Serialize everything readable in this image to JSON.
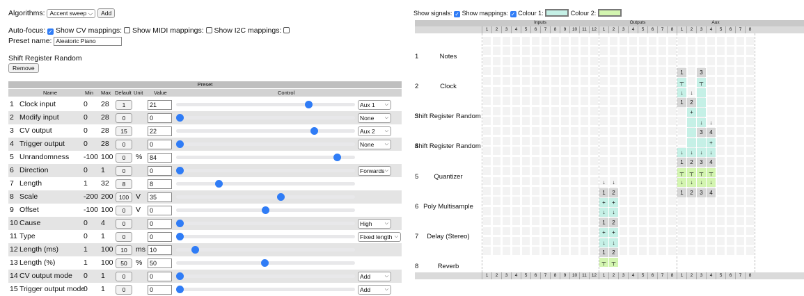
{
  "left_panel": {
    "algorithms_label": "Algorithms:",
    "algorithm_selected": "Accent sweep",
    "add_button": "Add",
    "auto_focus_label": "Auto-focus:",
    "show_cv_label": "Show CV mappings:",
    "show_midi_label": "Show MIDI mappings:",
    "show_i2c_label": "Show I2C mappings:",
    "preset_name_label": "Preset name:",
    "preset_name_value": "Aleatoric Piano",
    "algorithm_title": "Shift Register Random",
    "remove_button": "Remove",
    "table_title": "Preset",
    "headers": {
      "name": "Name",
      "min": "Min",
      "max": "Max",
      "default": "Default",
      "unit": "Unit",
      "value": "Value",
      "control": "Control"
    },
    "rows": [
      {
        "num": "1",
        "name": "Clock input",
        "min": "0",
        "max": "28",
        "default": "1",
        "unit": "",
        "value": "21",
        "slider": 0.75,
        "select": "Aux 1"
      },
      {
        "num": "2",
        "name": "Modify input",
        "min": "0",
        "max": "28",
        "default": "0",
        "unit": "",
        "value": "0",
        "slider": 0.0,
        "select": "None"
      },
      {
        "num": "3",
        "name": "CV output",
        "min": "0",
        "max": "28",
        "default": "15",
        "unit": "",
        "value": "22",
        "slider": 0.786,
        "select": "Aux 2"
      },
      {
        "num": "4",
        "name": "Trigger output",
        "min": "0",
        "max": "28",
        "default": "0",
        "unit": "",
        "value": "0",
        "slider": 0.0,
        "select": "None"
      },
      {
        "num": "5",
        "name": "Unrandomness",
        "min": "-100",
        "max": "100",
        "default": "0",
        "unit": "%",
        "value": "84",
        "slider": 0.92,
        "select": ""
      },
      {
        "num": "6",
        "name": "Direction",
        "min": "0",
        "max": "1",
        "default": "0",
        "unit": "",
        "value": "0",
        "slider": 0.0,
        "select": "Forwards"
      },
      {
        "num": "7",
        "name": "Length",
        "min": "1",
        "max": "32",
        "default": "8",
        "unit": "",
        "value": "8",
        "slider": 0.226,
        "select": ""
      },
      {
        "num": "8",
        "name": "Scale",
        "min": "-200",
        "max": "200",
        "default": "100",
        "unit": "V",
        "value": "35",
        "slider": 0.588,
        "select": ""
      },
      {
        "num": "9",
        "name": "Offset",
        "min": "-100",
        "max": "100",
        "default": "0",
        "unit": "V",
        "value": "0",
        "slider": 0.5,
        "select": ""
      },
      {
        "num": "10",
        "name": "Cause",
        "min": "0",
        "max": "4",
        "default": "0",
        "unit": "",
        "value": "0",
        "slider": 0.0,
        "select": "High"
      },
      {
        "num": "11",
        "name": "Type",
        "min": "0",
        "max": "1",
        "default": "0",
        "unit": "",
        "value": "0",
        "slider": 0.0,
        "select": "Fixed length"
      },
      {
        "num": "12",
        "name": "Length (ms)",
        "min": "1",
        "max": "100",
        "default": "10",
        "unit": "ms",
        "value": "10",
        "slider": 0.091,
        "select": ""
      },
      {
        "num": "13",
        "name": "Length (%)",
        "min": "1",
        "max": "100",
        "default": "50",
        "unit": "%",
        "value": "50",
        "slider": 0.495,
        "select": ""
      },
      {
        "num": "14",
        "name": "CV output mode",
        "min": "0",
        "max": "1",
        "default": "0",
        "unit": "",
        "value": "0",
        "slider": 0.0,
        "select": "Add"
      },
      {
        "num": "15",
        "name": "Trigger output mode",
        "min": "0",
        "max": "1",
        "default": "0",
        "unit": "",
        "value": "0",
        "slider": 0.0,
        "select": "Add"
      }
    ]
  },
  "right_panel": {
    "show_signals_label": "Show signals:",
    "show_mappings_label": "Show mappings:",
    "colour1_label": "Colour 1:",
    "colour2_label": "Colour 2:",
    "colour1": "#c5f0e6",
    "colour2": "#d3f5b0",
    "group_headers": {
      "inputs": "Inputs",
      "outputs": "Outputs",
      "aux": "Aux"
    },
    "input_numbers": [
      "1",
      "2",
      "3",
      "4",
      "5",
      "6",
      "7",
      "8",
      "9",
      "10",
      "11",
      "12"
    ],
    "output_numbers": [
      "1",
      "2",
      "3",
      "4",
      "5",
      "6",
      "7",
      "8"
    ],
    "aux_numbers": [
      "1",
      "2",
      "3",
      "4",
      "5",
      "6",
      "7",
      "8"
    ],
    "nodes": [
      {
        "num": "1",
        "name": "Notes"
      },
      {
        "num": "2",
        "name": "Clock"
      },
      {
        "num": "3",
        "name": "Shift Register Random"
      },
      {
        "num": "4",
        "name": "Shift Register Random"
      },
      {
        "num": "5",
        "name": "Quantizer"
      },
      {
        "num": "6",
        "name": "Poly Multisample"
      },
      {
        "num": "7",
        "name": "Delay (Stereo)"
      },
      {
        "num": "8",
        "name": "Reverb"
      }
    ],
    "signals": [
      {
        "row": 2,
        "col": 20,
        "text": "1",
        "c": "g"
      },
      {
        "row": 2,
        "col": 22,
        "text": "3",
        "c": "g"
      },
      {
        "row": 3,
        "col": 20,
        "text": "┬",
        "c": "c1"
      },
      {
        "row": 3,
        "col": 22,
        "text": "┬",
        "c": "c1"
      },
      {
        "row": 4,
        "col": 20,
        "text": "↓",
        "c": "c1"
      },
      {
        "row": 4,
        "col": 21,
        "text": "↓",
        "c": "n"
      },
      {
        "row": 4,
        "col": 22,
        "text": "",
        "c": "c1"
      },
      {
        "row": 5,
        "col": 20,
        "text": "1",
        "c": "g"
      },
      {
        "row": 5,
        "col": 21,
        "text": "2",
        "c": "g"
      },
      {
        "row": 5,
        "col": 22,
        "text": "",
        "c": "c1"
      },
      {
        "row": 6,
        "col": 21,
        "text": "+",
        "c": "c1"
      },
      {
        "row": 6,
        "col": 22,
        "text": "",
        "c": "c1"
      },
      {
        "row": 7,
        "col": 21,
        "text": "",
        "c": "c1"
      },
      {
        "row": 7,
        "col": 22,
        "text": "↓",
        "c": "c1"
      },
      {
        "row": 7,
        "col": 23,
        "text": "↓",
        "c": "n"
      },
      {
        "row": 8,
        "col": 21,
        "text": "",
        "c": "c1"
      },
      {
        "row": 8,
        "col": 22,
        "text": "3",
        "c": "g"
      },
      {
        "row": 8,
        "col": 23,
        "text": "4",
        "c": "g"
      },
      {
        "row": 9,
        "col": 21,
        "text": "",
        "c": "c1"
      },
      {
        "row": 9,
        "col": 22,
        "text": "",
        "c": "c1"
      },
      {
        "row": 9,
        "col": 23,
        "text": "+",
        "c": "c1"
      },
      {
        "row": 10,
        "col": 20,
        "text": "↓",
        "c": "c1"
      },
      {
        "row": 10,
        "col": 21,
        "text": "↓",
        "c": "c1"
      },
      {
        "row": 10,
        "col": 22,
        "text": "↓",
        "c": "c1"
      },
      {
        "row": 10,
        "col": 23,
        "text": "↓",
        "c": "c1"
      },
      {
        "row": 11,
        "col": 20,
        "text": "1",
        "c": "g"
      },
      {
        "row": 11,
        "col": 21,
        "text": "2",
        "c": "g"
      },
      {
        "row": 11,
        "col": 22,
        "text": "3",
        "c": "g"
      },
      {
        "row": 11,
        "col": 23,
        "text": "4",
        "c": "g"
      },
      {
        "row": 12,
        "col": 20,
        "text": "┬",
        "c": "c2"
      },
      {
        "row": 12,
        "col": 21,
        "text": "┬",
        "c": "c2"
      },
      {
        "row": 12,
        "col": 22,
        "text": "┬",
        "c": "c2"
      },
      {
        "row": 12,
        "col": 23,
        "text": "┬",
        "c": "c2"
      },
      {
        "row": 13,
        "col": 12,
        "text": "↓",
        "c": "n"
      },
      {
        "row": 13,
        "col": 13,
        "text": "↓",
        "c": "n"
      },
      {
        "row": 13,
        "col": 20,
        "text": "↓",
        "c": "c2"
      },
      {
        "row": 13,
        "col": 21,
        "text": "↓",
        "c": "c2"
      },
      {
        "row": 13,
        "col": 22,
        "text": "↓",
        "c": "c2"
      },
      {
        "row": 13,
        "col": 23,
        "text": "↓",
        "c": "c2"
      },
      {
        "row": 14,
        "col": 12,
        "text": "1",
        "c": "g"
      },
      {
        "row": 14,
        "col": 13,
        "text": "2",
        "c": "g"
      },
      {
        "row": 14,
        "col": 20,
        "text": "1",
        "c": "g"
      },
      {
        "row": 14,
        "col": 21,
        "text": "2",
        "c": "g"
      },
      {
        "row": 14,
        "col": 22,
        "text": "3",
        "c": "g"
      },
      {
        "row": 14,
        "col": 23,
        "text": "4",
        "c": "g"
      },
      {
        "row": 15,
        "col": 12,
        "text": "+",
        "c": "c1"
      },
      {
        "row": 15,
        "col": 13,
        "text": "+",
        "c": "c1"
      },
      {
        "row": 16,
        "col": 12,
        "text": "↓",
        "c": "c1"
      },
      {
        "row": 16,
        "col": 13,
        "text": "↓",
        "c": "c1"
      },
      {
        "row": 17,
        "col": 12,
        "text": "1",
        "c": "g"
      },
      {
        "row": 17,
        "col": 13,
        "text": "2",
        "c": "g"
      },
      {
        "row": 18,
        "col": 12,
        "text": "+",
        "c": "c1"
      },
      {
        "row": 18,
        "col": 13,
        "text": "+",
        "c": "c1"
      },
      {
        "row": 19,
        "col": 12,
        "text": "↓",
        "c": "c1"
      },
      {
        "row": 19,
        "col": 13,
        "text": "↓",
        "c": "c1"
      },
      {
        "row": 20,
        "col": 12,
        "text": "1",
        "c": "g"
      },
      {
        "row": 20,
        "col": 13,
        "text": "2",
        "c": "g"
      },
      {
        "row": 21,
        "col": 12,
        "text": "┬",
        "c": "c2"
      },
      {
        "row": 21,
        "col": 13,
        "text": "┬",
        "c": "c2"
      }
    ]
  }
}
